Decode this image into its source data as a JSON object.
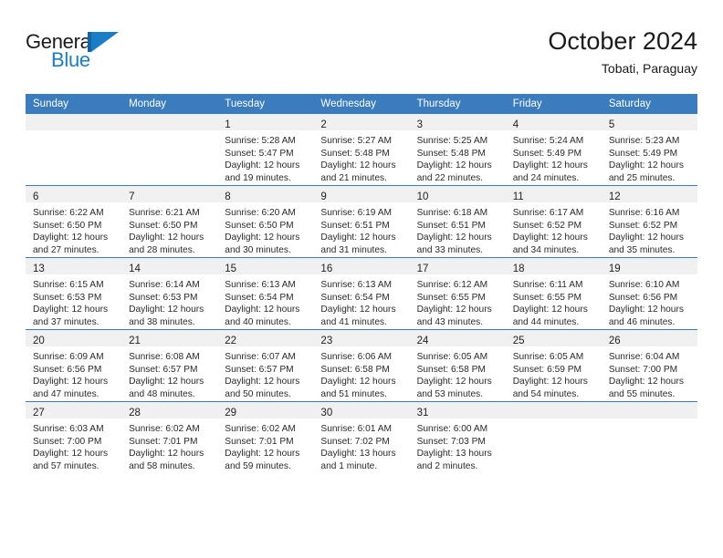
{
  "brand": {
    "name_part1": "General",
    "name_part2": "Blue",
    "triangle_color": "#1a7ec6",
    "accent_color": "#3b7cbe"
  },
  "header": {
    "title": "October 2024",
    "subtitle": "Tobati, Paraguay"
  },
  "calendar": {
    "weekday_headers": [
      "Sunday",
      "Monday",
      "Tuesday",
      "Wednesday",
      "Thursday",
      "Friday",
      "Saturday"
    ],
    "weeks": [
      [
        {
          "day": "",
          "lines": []
        },
        {
          "day": "",
          "lines": []
        },
        {
          "day": "1",
          "lines": [
            "Sunrise: 5:28 AM",
            "Sunset: 5:47 PM",
            "Daylight: 12 hours",
            "and 19 minutes."
          ]
        },
        {
          "day": "2",
          "lines": [
            "Sunrise: 5:27 AM",
            "Sunset: 5:48 PM",
            "Daylight: 12 hours",
            "and 21 minutes."
          ]
        },
        {
          "day": "3",
          "lines": [
            "Sunrise: 5:25 AM",
            "Sunset: 5:48 PM",
            "Daylight: 12 hours",
            "and 22 minutes."
          ]
        },
        {
          "day": "4",
          "lines": [
            "Sunrise: 5:24 AM",
            "Sunset: 5:49 PM",
            "Daylight: 12 hours",
            "and 24 minutes."
          ]
        },
        {
          "day": "5",
          "lines": [
            "Sunrise: 5:23 AM",
            "Sunset: 5:49 PM",
            "Daylight: 12 hours",
            "and 25 minutes."
          ]
        }
      ],
      [
        {
          "day": "6",
          "lines": [
            "Sunrise: 6:22 AM",
            "Sunset: 6:50 PM",
            "Daylight: 12 hours",
            "and 27 minutes."
          ]
        },
        {
          "day": "7",
          "lines": [
            "Sunrise: 6:21 AM",
            "Sunset: 6:50 PM",
            "Daylight: 12 hours",
            "and 28 minutes."
          ]
        },
        {
          "day": "8",
          "lines": [
            "Sunrise: 6:20 AM",
            "Sunset: 6:50 PM",
            "Daylight: 12 hours",
            "and 30 minutes."
          ]
        },
        {
          "day": "9",
          "lines": [
            "Sunrise: 6:19 AM",
            "Sunset: 6:51 PM",
            "Daylight: 12 hours",
            "and 31 minutes."
          ]
        },
        {
          "day": "10",
          "lines": [
            "Sunrise: 6:18 AM",
            "Sunset: 6:51 PM",
            "Daylight: 12 hours",
            "and 33 minutes."
          ]
        },
        {
          "day": "11",
          "lines": [
            "Sunrise: 6:17 AM",
            "Sunset: 6:52 PM",
            "Daylight: 12 hours",
            "and 34 minutes."
          ]
        },
        {
          "day": "12",
          "lines": [
            "Sunrise: 6:16 AM",
            "Sunset: 6:52 PM",
            "Daylight: 12 hours",
            "and 35 minutes."
          ]
        }
      ],
      [
        {
          "day": "13",
          "lines": [
            "Sunrise: 6:15 AM",
            "Sunset: 6:53 PM",
            "Daylight: 12 hours",
            "and 37 minutes."
          ]
        },
        {
          "day": "14",
          "lines": [
            "Sunrise: 6:14 AM",
            "Sunset: 6:53 PM",
            "Daylight: 12 hours",
            "and 38 minutes."
          ]
        },
        {
          "day": "15",
          "lines": [
            "Sunrise: 6:13 AM",
            "Sunset: 6:54 PM",
            "Daylight: 12 hours",
            "and 40 minutes."
          ]
        },
        {
          "day": "16",
          "lines": [
            "Sunrise: 6:13 AM",
            "Sunset: 6:54 PM",
            "Daylight: 12 hours",
            "and 41 minutes."
          ]
        },
        {
          "day": "17",
          "lines": [
            "Sunrise: 6:12 AM",
            "Sunset: 6:55 PM",
            "Daylight: 12 hours",
            "and 43 minutes."
          ]
        },
        {
          "day": "18",
          "lines": [
            "Sunrise: 6:11 AM",
            "Sunset: 6:55 PM",
            "Daylight: 12 hours",
            "and 44 minutes."
          ]
        },
        {
          "day": "19",
          "lines": [
            "Sunrise: 6:10 AM",
            "Sunset: 6:56 PM",
            "Daylight: 12 hours",
            "and 46 minutes."
          ]
        }
      ],
      [
        {
          "day": "20",
          "lines": [
            "Sunrise: 6:09 AM",
            "Sunset: 6:56 PM",
            "Daylight: 12 hours",
            "and 47 minutes."
          ]
        },
        {
          "day": "21",
          "lines": [
            "Sunrise: 6:08 AM",
            "Sunset: 6:57 PM",
            "Daylight: 12 hours",
            "and 48 minutes."
          ]
        },
        {
          "day": "22",
          "lines": [
            "Sunrise: 6:07 AM",
            "Sunset: 6:57 PM",
            "Daylight: 12 hours",
            "and 50 minutes."
          ]
        },
        {
          "day": "23",
          "lines": [
            "Sunrise: 6:06 AM",
            "Sunset: 6:58 PM",
            "Daylight: 12 hours",
            "and 51 minutes."
          ]
        },
        {
          "day": "24",
          "lines": [
            "Sunrise: 6:05 AM",
            "Sunset: 6:58 PM",
            "Daylight: 12 hours",
            "and 53 minutes."
          ]
        },
        {
          "day": "25",
          "lines": [
            "Sunrise: 6:05 AM",
            "Sunset: 6:59 PM",
            "Daylight: 12 hours",
            "and 54 minutes."
          ]
        },
        {
          "day": "26",
          "lines": [
            "Sunrise: 6:04 AM",
            "Sunset: 7:00 PM",
            "Daylight: 12 hours",
            "and 55 minutes."
          ]
        }
      ],
      [
        {
          "day": "27",
          "lines": [
            "Sunrise: 6:03 AM",
            "Sunset: 7:00 PM",
            "Daylight: 12 hours",
            "and 57 minutes."
          ]
        },
        {
          "day": "28",
          "lines": [
            "Sunrise: 6:02 AM",
            "Sunset: 7:01 PM",
            "Daylight: 12 hours",
            "and 58 minutes."
          ]
        },
        {
          "day": "29",
          "lines": [
            "Sunrise: 6:02 AM",
            "Sunset: 7:01 PM",
            "Daylight: 12 hours",
            "and 59 minutes."
          ]
        },
        {
          "day": "30",
          "lines": [
            "Sunrise: 6:01 AM",
            "Sunset: 7:02 PM",
            "Daylight: 13 hours",
            "and 1 minute."
          ]
        },
        {
          "day": "31",
          "lines": [
            "Sunrise: 6:00 AM",
            "Sunset: 7:03 PM",
            "Daylight: 13 hours",
            "and 2 minutes."
          ]
        },
        {
          "day": "",
          "lines": []
        },
        {
          "day": "",
          "lines": []
        }
      ]
    ]
  }
}
